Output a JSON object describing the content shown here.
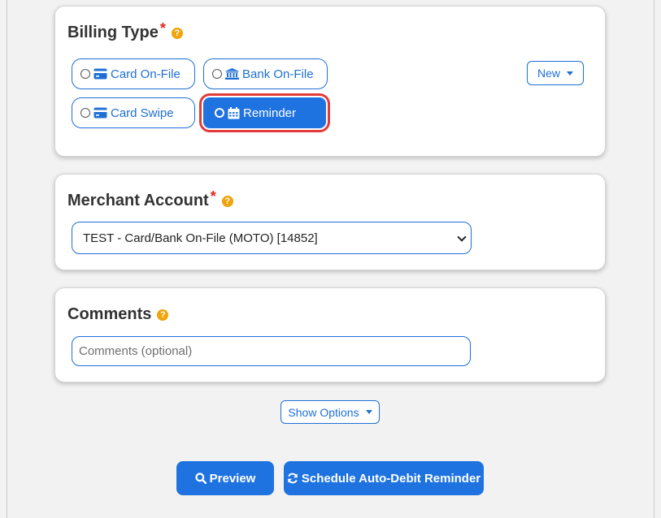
{
  "billing_type": {
    "title": "Billing Type",
    "required_mark": "*",
    "help": "?",
    "options": [
      {
        "label": "Card On-File",
        "icon": "credit-card-icon"
      },
      {
        "label": "Bank On-File",
        "icon": "bank-icon"
      },
      {
        "label": "Card Swipe",
        "icon": "credit-card-icon"
      },
      {
        "label": "Reminder",
        "icon": "calendar-icon",
        "selected": true
      }
    ],
    "new_button": "New"
  },
  "merchant_account": {
    "title": "Merchant Account",
    "required_mark": "*",
    "help": "?",
    "selected": "TEST - Card/Bank On-File (MOTO) [14852]"
  },
  "comments": {
    "title": "Comments",
    "help": "?",
    "value": "",
    "placeholder": "Comments (optional)"
  },
  "show_options": "Show Options",
  "actions": {
    "preview": "Preview",
    "schedule": "Schedule Auto-Debit Reminder"
  },
  "colors": {
    "primary": "#1f73e0",
    "required": "#e0261b",
    "help": "#f0a30a",
    "highlight": "#e33a3a"
  }
}
